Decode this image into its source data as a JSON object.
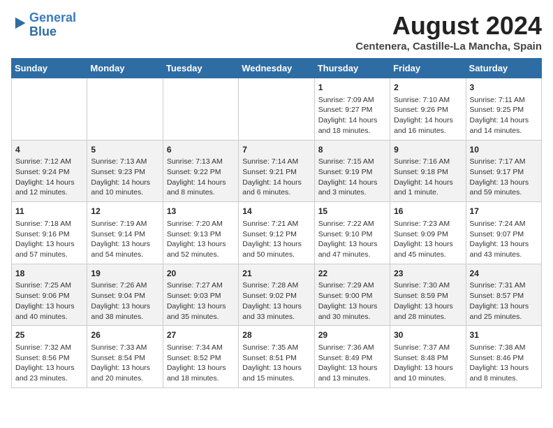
{
  "header": {
    "logo_line1": "General",
    "logo_line2": "Blue",
    "main_title": "August 2024",
    "subtitle": "Centenera, Castille-La Mancha, Spain"
  },
  "calendar": {
    "weekdays": [
      "Sunday",
      "Monday",
      "Tuesday",
      "Wednesday",
      "Thursday",
      "Friday",
      "Saturday"
    ],
    "weeks": [
      [
        {
          "day": "",
          "info": ""
        },
        {
          "day": "",
          "info": ""
        },
        {
          "day": "",
          "info": ""
        },
        {
          "day": "",
          "info": ""
        },
        {
          "day": "1",
          "info": "Sunrise: 7:09 AM\nSunset: 9:27 PM\nDaylight: 14 hours\nand 18 minutes."
        },
        {
          "day": "2",
          "info": "Sunrise: 7:10 AM\nSunset: 9:26 PM\nDaylight: 14 hours\nand 16 minutes."
        },
        {
          "day": "3",
          "info": "Sunrise: 7:11 AM\nSunset: 9:25 PM\nDaylight: 14 hours\nand 14 minutes."
        }
      ],
      [
        {
          "day": "4",
          "info": "Sunrise: 7:12 AM\nSunset: 9:24 PM\nDaylight: 14 hours\nand 12 minutes."
        },
        {
          "day": "5",
          "info": "Sunrise: 7:13 AM\nSunset: 9:23 PM\nDaylight: 14 hours\nand 10 minutes."
        },
        {
          "day": "6",
          "info": "Sunrise: 7:13 AM\nSunset: 9:22 PM\nDaylight: 14 hours\nand 8 minutes."
        },
        {
          "day": "7",
          "info": "Sunrise: 7:14 AM\nSunset: 9:21 PM\nDaylight: 14 hours\nand 6 minutes."
        },
        {
          "day": "8",
          "info": "Sunrise: 7:15 AM\nSunset: 9:19 PM\nDaylight: 14 hours\nand 3 minutes."
        },
        {
          "day": "9",
          "info": "Sunrise: 7:16 AM\nSunset: 9:18 PM\nDaylight: 14 hours\nand 1 minute."
        },
        {
          "day": "10",
          "info": "Sunrise: 7:17 AM\nSunset: 9:17 PM\nDaylight: 13 hours\nand 59 minutes."
        }
      ],
      [
        {
          "day": "11",
          "info": "Sunrise: 7:18 AM\nSunset: 9:16 PM\nDaylight: 13 hours\nand 57 minutes."
        },
        {
          "day": "12",
          "info": "Sunrise: 7:19 AM\nSunset: 9:14 PM\nDaylight: 13 hours\nand 54 minutes."
        },
        {
          "day": "13",
          "info": "Sunrise: 7:20 AM\nSunset: 9:13 PM\nDaylight: 13 hours\nand 52 minutes."
        },
        {
          "day": "14",
          "info": "Sunrise: 7:21 AM\nSunset: 9:12 PM\nDaylight: 13 hours\nand 50 minutes."
        },
        {
          "day": "15",
          "info": "Sunrise: 7:22 AM\nSunset: 9:10 PM\nDaylight: 13 hours\nand 47 minutes."
        },
        {
          "day": "16",
          "info": "Sunrise: 7:23 AM\nSunset: 9:09 PM\nDaylight: 13 hours\nand 45 minutes."
        },
        {
          "day": "17",
          "info": "Sunrise: 7:24 AM\nSunset: 9:07 PM\nDaylight: 13 hours\nand 43 minutes."
        }
      ],
      [
        {
          "day": "18",
          "info": "Sunrise: 7:25 AM\nSunset: 9:06 PM\nDaylight: 13 hours\nand 40 minutes."
        },
        {
          "day": "19",
          "info": "Sunrise: 7:26 AM\nSunset: 9:04 PM\nDaylight: 13 hours\nand 38 minutes."
        },
        {
          "day": "20",
          "info": "Sunrise: 7:27 AM\nSunset: 9:03 PM\nDaylight: 13 hours\nand 35 minutes."
        },
        {
          "day": "21",
          "info": "Sunrise: 7:28 AM\nSunset: 9:02 PM\nDaylight: 13 hours\nand 33 minutes."
        },
        {
          "day": "22",
          "info": "Sunrise: 7:29 AM\nSunset: 9:00 PM\nDaylight: 13 hours\nand 30 minutes."
        },
        {
          "day": "23",
          "info": "Sunrise: 7:30 AM\nSunset: 8:59 PM\nDaylight: 13 hours\nand 28 minutes."
        },
        {
          "day": "24",
          "info": "Sunrise: 7:31 AM\nSunset: 8:57 PM\nDaylight: 13 hours\nand 25 minutes."
        }
      ],
      [
        {
          "day": "25",
          "info": "Sunrise: 7:32 AM\nSunset: 8:56 PM\nDaylight: 13 hours\nand 23 minutes."
        },
        {
          "day": "26",
          "info": "Sunrise: 7:33 AM\nSunset: 8:54 PM\nDaylight: 13 hours\nand 20 minutes."
        },
        {
          "day": "27",
          "info": "Sunrise: 7:34 AM\nSunset: 8:52 PM\nDaylight: 13 hours\nand 18 minutes."
        },
        {
          "day": "28",
          "info": "Sunrise: 7:35 AM\nSunset: 8:51 PM\nDaylight: 13 hours\nand 15 minutes."
        },
        {
          "day": "29",
          "info": "Sunrise: 7:36 AM\nSunset: 8:49 PM\nDaylight: 13 hours\nand 13 minutes."
        },
        {
          "day": "30",
          "info": "Sunrise: 7:37 AM\nSunset: 8:48 PM\nDaylight: 13 hours\nand 10 minutes."
        },
        {
          "day": "31",
          "info": "Sunrise: 7:38 AM\nSunset: 8:46 PM\nDaylight: 13 hours\nand 8 minutes."
        }
      ]
    ]
  }
}
